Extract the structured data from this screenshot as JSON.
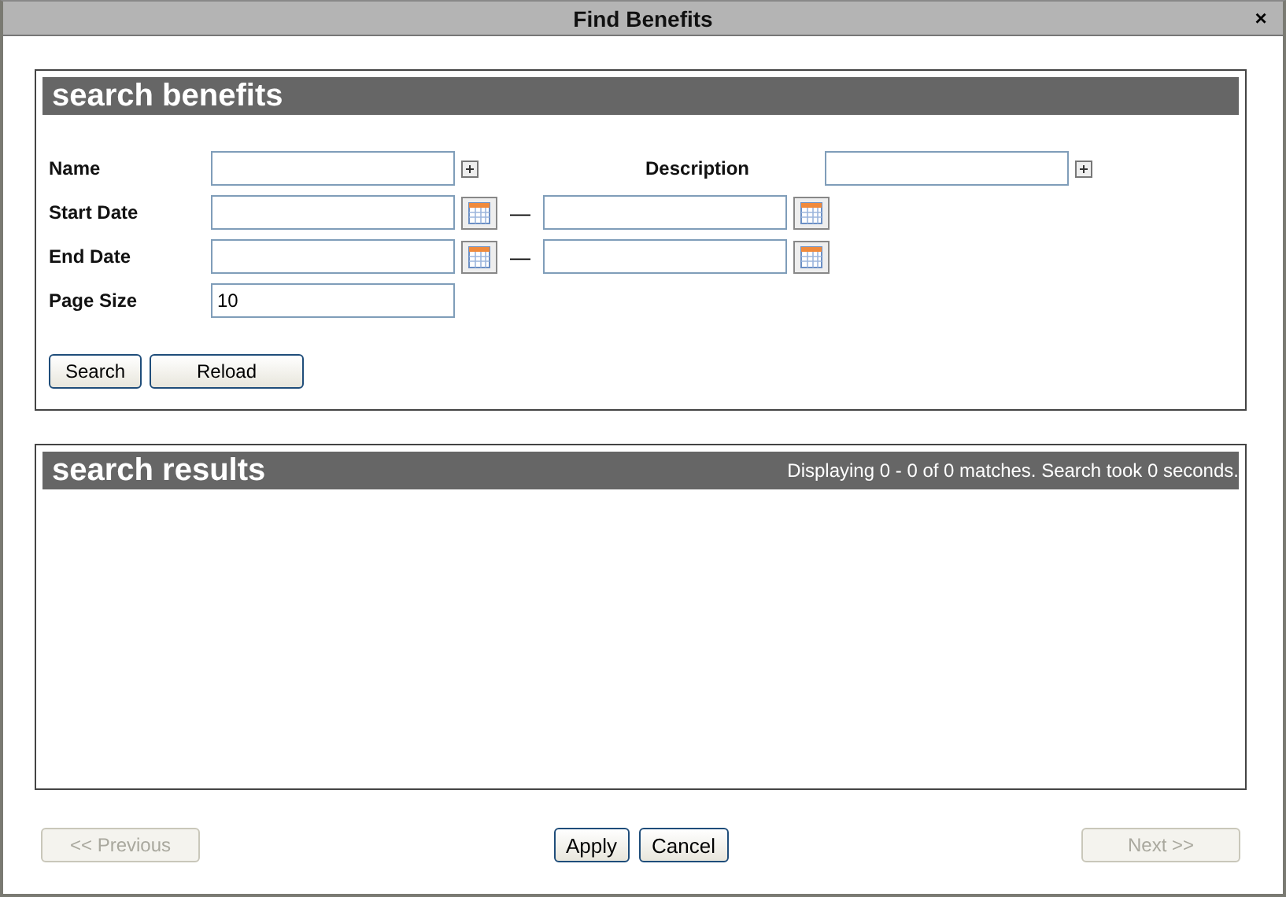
{
  "window": {
    "title": "Find Benefits",
    "close": "×"
  },
  "search_panel": {
    "title": "search benefits",
    "name": {
      "label": "Name"
    },
    "description": {
      "label": "Description"
    },
    "date_ranges": [
      {
        "label": "Start Date",
        "separator": "—"
      },
      {
        "label": "End Date",
        "separator": "—"
      }
    ],
    "page_size": {
      "label": "Page Size",
      "value": "10"
    },
    "buttons": [
      "Search",
      "Reload"
    ]
  },
  "results_panel": {
    "title": "search results",
    "summary": "Displaying 0 - 0 of 0 matches. Search took 0 seconds."
  },
  "footer": {
    "buttons": [
      {
        "label": "<< Previous",
        "disabled": true
      },
      {
        "label": "Apply",
        "disabled": false
      },
      {
        "label": "Cancel",
        "disabled": false
      },
      {
        "label": "Next >>",
        "disabled": true
      }
    ]
  }
}
